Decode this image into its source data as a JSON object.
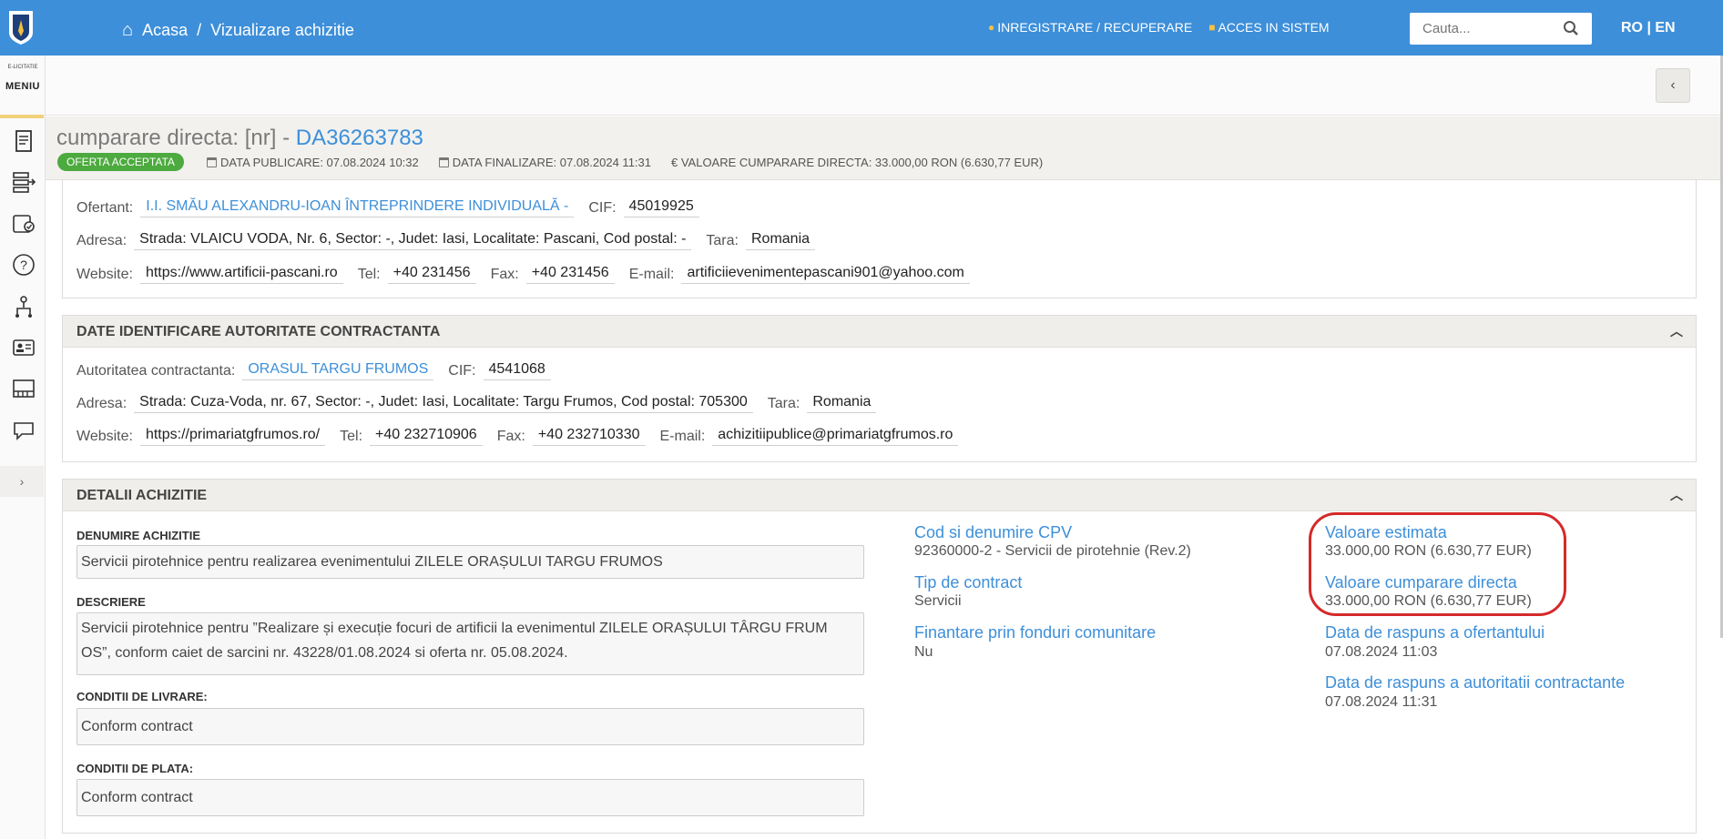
{
  "header": {
    "breadcrumb": {
      "home": "Acasa",
      "separator": "/",
      "current": "Vizualizare achizitie"
    },
    "links": {
      "register": "INREGISTRARE / RECUPERARE",
      "login": "ACCES IN SISTEM"
    },
    "search_placeholder": "Cauta...",
    "lang": "RO | EN"
  },
  "sidebar": {
    "brand": "E-LICITATIE",
    "menu_label": "MENIU",
    "icons": [
      "document-icon",
      "export-list-icon",
      "wallet-check-icon",
      "help-icon",
      "sitemap-icon",
      "id-card-icon",
      "library-icon",
      "chat-icon"
    ],
    "expand_label": "›"
  },
  "title": {
    "prefix": "cumparare directa: [nr] -",
    "code": "DA36263783",
    "status": "OFERTA ACCEPTATA",
    "data_publicare": "DATA PUBLICARE: 07.08.2024 10:32",
    "data_finalizare": "DATA FINALIZARE: 07.08.2024 11:31",
    "valoare": "€ VALOARE CUMPARARE DIRECTA: 33.000,00  RON (6.630,77  EUR)"
  },
  "ofertant": {
    "label_ofertant": "Ofertant:",
    "ofertant": "I.I. SMĂU ALEXANDRU-IOAN ÎNTREPRINDERE INDIVIDUALĂ -",
    "label_cif": "CIF:",
    "cif": "45019925",
    "label_adresa": "Adresa:",
    "adresa": "Strada: VLAICU VODA, Nr. 6, Sector: -, Judet: Iasi, Localitate: Pascani, Cod postal: -",
    "label_tara": "Tara:",
    "tara": "Romania",
    "label_website": "Website:",
    "website": "https://www.artificii-pascani.ro",
    "label_tel": "Tel:",
    "tel": "+40 231456",
    "label_fax": "Fax:",
    "fax": "+40 231456",
    "label_email": "E-mail:",
    "email": "artificiievenimentepascani901@yahoo.com"
  },
  "autoritate": {
    "heading": "DATE IDENTIFICARE AUTORITATE CONTRACTANTA",
    "label_autoritate": "Autoritatea contractanta:",
    "autoritate": "ORASUL TARGU FRUMOS",
    "label_cif": "CIF:",
    "cif": "4541068",
    "label_adresa": "Adresa:",
    "adresa": "Strada: Cuza-Voda, nr. 67, Sector: -, Judet: Iasi, Localitate: Targu Frumos, Cod postal: 705300",
    "label_tara": "Tara:",
    "tara": "Romania",
    "label_website": "Website:",
    "website": "https://primariatgfrumos.ro/",
    "label_tel": "Tel:",
    "tel": "+40 232710906",
    "label_fax": "Fax:",
    "fax": "+40 232710330",
    "label_email": "E-mail:",
    "email": "achizitiipublice@primariatgfrumos.ro"
  },
  "detalii": {
    "heading": "DETALII ACHIZITIE",
    "denumire_label": "DENUMIRE ACHIZITIE",
    "denumire": "Servicii pirotehnice pentru realizarea evenimentului ZILELE ORAȘULUI TARGU FRUMOS",
    "descriere_label": "DESCRIERE",
    "descriere": "Servicii pirotehnice pentru ”Realizare și execuție focuri de artificii la evenimentul ZILELE ORAȘULUI TÂRGU FRUM OS”, conform caiet de sarcini nr. 43228/01.08.2024 si oferta nr. 05.08.2024.",
    "livrare_label": "CONDITII DE LIVRARE:",
    "livrare": "Conform contract",
    "plata_label": "CONDITII DE PLATA:",
    "plata": "Conform contract",
    "cpv_label": "Cod si denumire CPV",
    "cpv": "92360000-2 - Servicii de pirotehnie (Rev.2)",
    "tip_label": "Tip de contract",
    "tip": "Servicii",
    "finantare_label": "Finantare prin fonduri comunitare",
    "finantare": "Nu",
    "estimata_label": "Valoare estimata",
    "estimata": "33.000,00  RON (6.630,77  EUR)",
    "cumparare_label": "Valoare cumparare directa",
    "cumparare": "33.000,00  RON (6.630,77  EUR)",
    "raspuns_ofertant_label": "Data de raspuns a ofertantului",
    "raspuns_ofertant": "07.08.2024 11:03",
    "raspuns_autoritate_label": "Data de raspuns a autoritatii contractante",
    "raspuns_autoritate": "07.08.2024 11:31"
  },
  "colors": {
    "brand_blue": "#3d8fd9",
    "status_green": "#4caa3e",
    "highlight_red": "#d42a2a"
  }
}
